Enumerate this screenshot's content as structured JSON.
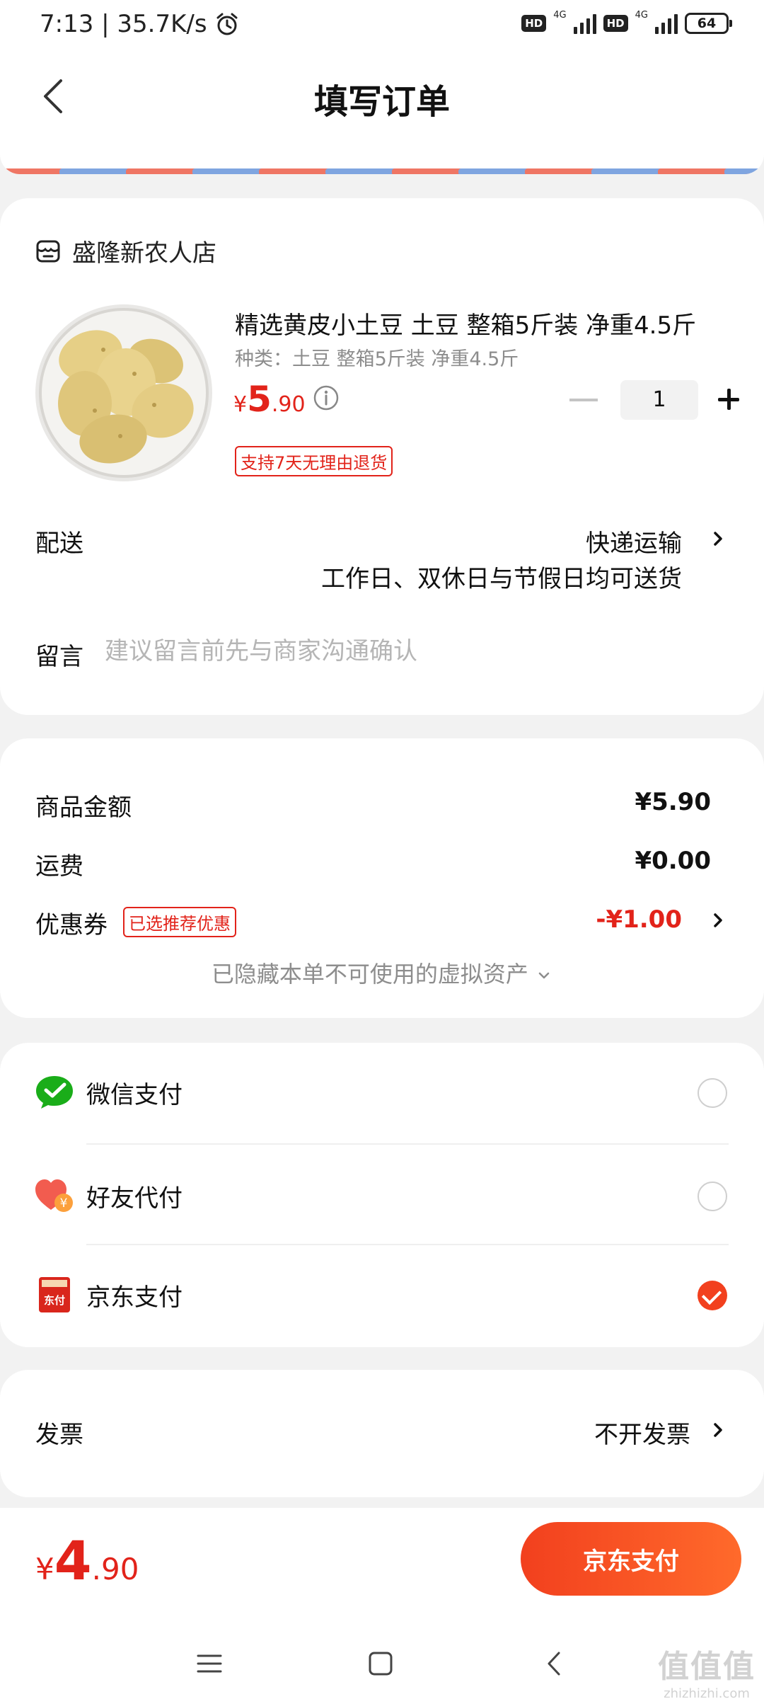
{
  "status_bar": {
    "time_speed": "7:13 | 35.7K/s",
    "hd1": "HD",
    "net1": "4G",
    "hd2": "HD",
    "net2": "4G",
    "battery": "64"
  },
  "header": {
    "title": "填写订单"
  },
  "shop": {
    "name": "盛隆新农人店"
  },
  "product": {
    "title": "精选黄皮小土豆 土豆  整箱5斤装 净重4.5斤",
    "spec": "种类：土豆  整箱5斤装 净重4.5斤",
    "price_symbol": "¥",
    "price_int": "5",
    "price_dec": ".90",
    "quantity": "1",
    "return_badge": "支持7天无理由退货"
  },
  "delivery": {
    "label": "配送",
    "value": "快递运输",
    "note": "工作日、双休日与节假日均可送货"
  },
  "message": {
    "label": "留言",
    "placeholder": "建议留言前先与商家沟通确认"
  },
  "summary": {
    "goods_label": "商品金额",
    "goods_value": "¥5.90",
    "shipping_label": "运费",
    "shipping_value": "¥0.00",
    "coupon_label": "优惠券",
    "coupon_badge": "已选推荐优惠",
    "coupon_value": "-¥1.00",
    "hidden_assets": "已隐藏本单不可使用的虚拟资产"
  },
  "payment": {
    "methods": [
      {
        "label": "微信支付",
        "selected": false
      },
      {
        "label": "好友代付",
        "selected": false
      },
      {
        "label": "京东支付",
        "selected": true
      }
    ],
    "jd_icon_text": "东付",
    "friend_icon_text": "¥"
  },
  "invoice": {
    "label": "发票",
    "value": "不开发票"
  },
  "bottom": {
    "total_symbol": "¥",
    "total_int": "4",
    "total_dec": ".90",
    "pay_button": "京东支付"
  },
  "watermark": {
    "big": "值值值",
    "small": "zhizhizhi.com"
  },
  "colors": {
    "accent": "#e2231a",
    "button_start": "#f2401e",
    "button_end": "#ff6a2b",
    "wechat_green": "#1aad19"
  }
}
